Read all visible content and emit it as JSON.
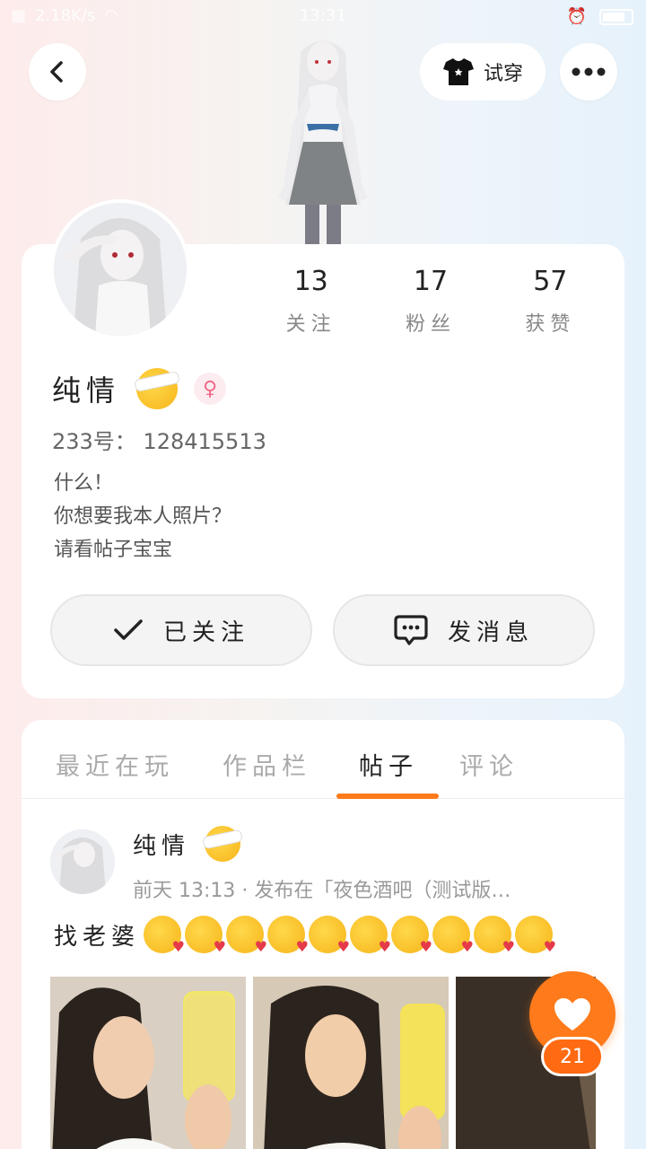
{
  "status_bar": {
    "speed": "2.18K/s",
    "time": "13:31"
  },
  "header": {
    "tryon_label": "试穿"
  },
  "profile": {
    "stats": [
      {
        "value": "13",
        "label": "关注"
      },
      {
        "value": "17",
        "label": "粉丝"
      },
      {
        "value": "57",
        "label": "获赞"
      }
    ],
    "nickname": "纯情",
    "gender_symbol": "♀",
    "uid": "233号： 128415513",
    "bio": [
      "什么！",
      "你想要我本人照片？",
      "请看帖子宝宝"
    ],
    "follow_label": "已关注",
    "message_label": "发消息"
  },
  "tabs": [
    {
      "label": "最近在玩"
    },
    {
      "label": "作品栏"
    },
    {
      "label": "帖子"
    },
    {
      "label": "评论"
    }
  ],
  "post": {
    "author": "纯情",
    "meta": "前天 13:13 · 发布在「夜色酒吧（测试版…",
    "text": "找老婆",
    "kiss_emoji_count": 10
  },
  "like": {
    "count": "21"
  },
  "colors": {
    "accent": "#ff7a1a",
    "gender": "#f06a8a"
  }
}
